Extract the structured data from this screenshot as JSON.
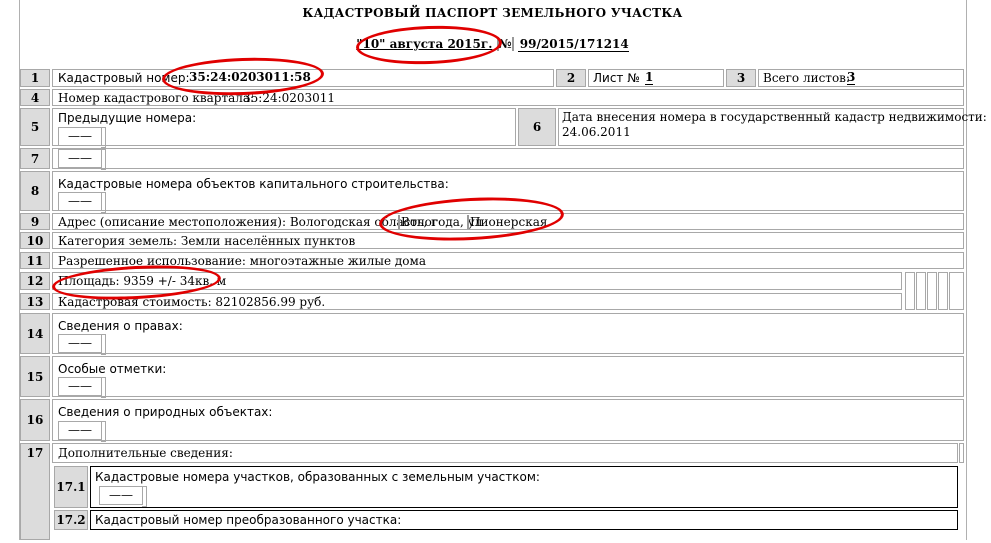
{
  "header": {
    "title": "КАДАСТРОВЫЙ ПАСПОРТ ЗЕМЕЛЬНОГО УЧАСТКА",
    "date": "\"10\" августа 2015г.",
    "number_label": "№",
    "number": "99/2015/171214"
  },
  "rows": {
    "r1": {
      "num": "1",
      "label": "Кадастровый номер:",
      "value": "35:24:0203011:58",
      "num2": "2",
      "sheet_label": "Лист №",
      "sheet": "1",
      "num3": "3",
      "total_label": "Всего листов:",
      "total": "3"
    },
    "r4": {
      "num": "4",
      "label": "Номер кадастрового квартала:",
      "value": "35:24:0203011"
    },
    "r5": {
      "num": "5",
      "label": "Предыдущие номера:",
      "dash": "——"
    },
    "r6": {
      "num": "6",
      "label": "Дата внесения номера в государственный кадастр недвижимости:",
      "value": "24.06.2011"
    },
    "r7": {
      "num": "7",
      "dash": "——"
    },
    "r8": {
      "num": "8",
      "label": "Кадастровые номера объектов капитального строительства:",
      "dash": "——"
    },
    "r9": {
      "num": "9",
      "label": "Адрес (описание местоположения): Вологодская область, г",
      "city": "Вологода, ул",
      "street": "Пионерская"
    },
    "r10": {
      "num": "10",
      "label": "Категория земель: Земли населённых пунктов"
    },
    "r11": {
      "num": "11",
      "label": "Разрешенное использование: многоэтажные жилые дома"
    },
    "r12": {
      "num": "12",
      "label": "Площадь: 9359 +/- 34кв. м"
    },
    "r13": {
      "num": "13",
      "label": "Кадастровая стоимость: 82102856.99 руб."
    },
    "r14": {
      "num": "14",
      "label": "Сведения о правах:",
      "dash": "——"
    },
    "r15": {
      "num": "15",
      "label": "Особые отметки:",
      "dash": "——"
    },
    "r16": {
      "num": "16",
      "label": "Сведения о природных объектах:",
      "dash": "——"
    },
    "r17": {
      "num": "17",
      "label": "Дополнительные сведения:"
    },
    "r17_1": {
      "num": "17.1",
      "label": "Кадастровые номера участков, образованных с земельным участком:",
      "dash": "——"
    },
    "r17_2": {
      "num": "17.2",
      "label": "Кадастровый номер преобразованного участка:"
    }
  },
  "colors": {
    "highlight": "#e00000",
    "numcell": "#dcdcdc",
    "border": "#a8a8a8"
  }
}
